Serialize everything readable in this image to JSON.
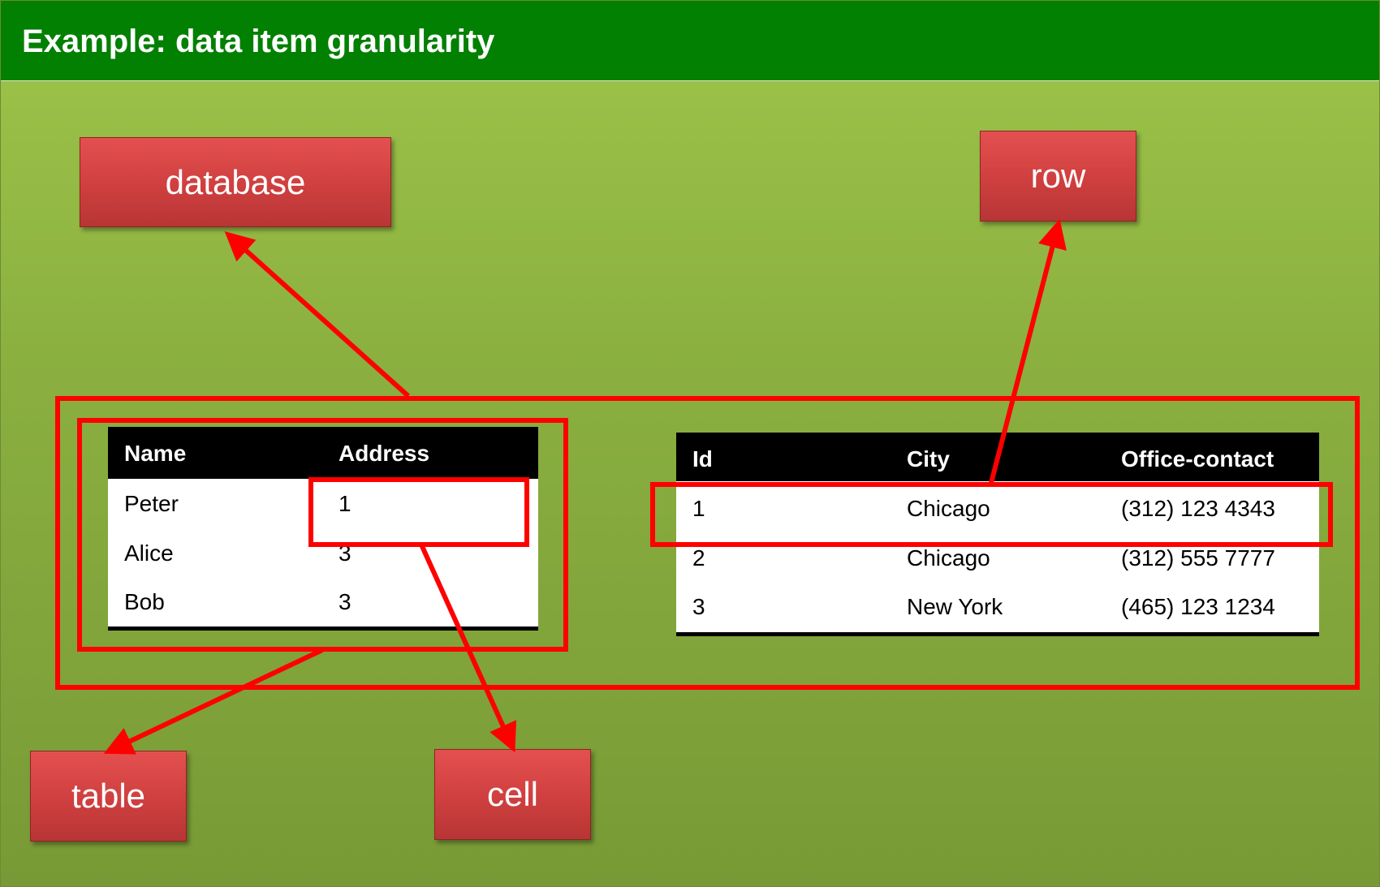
{
  "title": "Example: data item granularity",
  "labels": {
    "database": "database",
    "row": "row",
    "table": "table",
    "cell": "cell"
  },
  "people_table": {
    "headers": [
      "Name",
      "Address"
    ],
    "rows": [
      [
        "Peter",
        "1"
      ],
      [
        "Alice",
        "3"
      ],
      [
        "Bob",
        "3"
      ]
    ]
  },
  "offices_table": {
    "headers": [
      "Id",
      "City",
      "Office-contact"
    ],
    "rows": [
      [
        "1",
        "Chicago",
        "(312) 123 4343"
      ],
      [
        "2",
        "Chicago",
        "(312) 555 7777"
      ],
      [
        "3",
        "New York",
        "(465) 123 1234"
      ]
    ]
  },
  "colors": {
    "title_bar": "#028002",
    "background": "#8bb040",
    "highlight": "#ff0000",
    "label_box": "#cf3f3f"
  }
}
